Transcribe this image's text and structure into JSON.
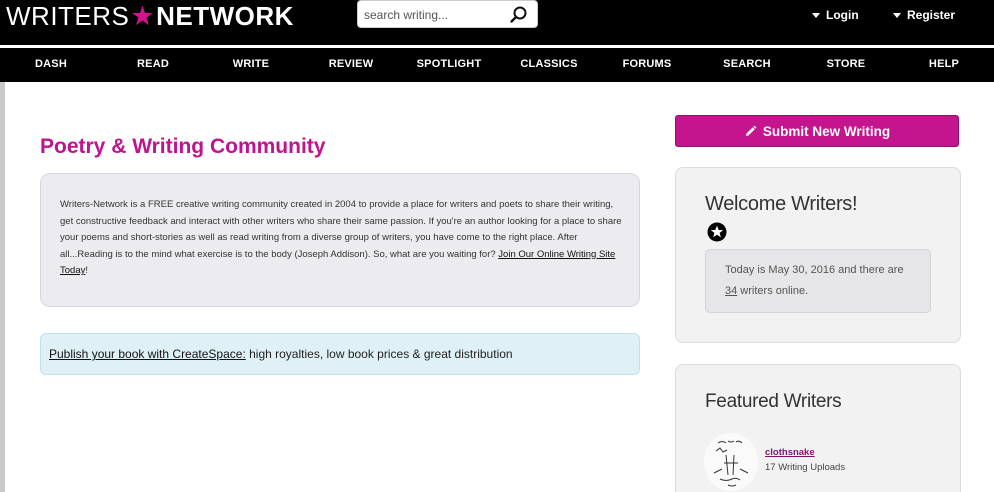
{
  "header": {
    "logo_left": "WRITERS",
    "logo_star": "★",
    "logo_right": "NETWORK",
    "search_placeholder": "search writing...",
    "login_label": "Login",
    "register_label": "Register"
  },
  "nav": {
    "items": [
      "DASH",
      "READ",
      "WRITE",
      "REVIEW",
      "SPOTLIGHT",
      "CLASSICS",
      "FORUMS",
      "SEARCH",
      "STORE",
      "HELP"
    ]
  },
  "main": {
    "title": "Poetry & Writing Community",
    "intro_text": "Writers-Network is a FREE creative writing community created in 2004 to provide a place for writers and poets to share their writing, get constructive feedback and interact with other writers who share their same passion. If you're an author looking for a place to share your poems and short-stories as well as read writing from a diverse group of writers, you have come to the right place. After all...Reading is to the mind what exercise is to the body (Joseph Addison). So, what are you waiting for?",
    "intro_link": "Join Our Online Writing Site Today",
    "intro_suffix": "!",
    "publish_link": "Publish your book with CreateSpace:",
    "publish_text": " high royalties, low book prices & great distribution"
  },
  "sidebar": {
    "submit_label": "Submit New Writing",
    "welcome_title": "Welcome Writers!",
    "today_text": "Today is May 30, 2016 and there are",
    "online_count": "34",
    "online_suffix": " writers online.",
    "featured_title": "Featured Writers",
    "featured_writer": {
      "name": "clothsnake",
      "uploads": "17 Writing Uploads"
    }
  },
  "colors": {
    "brand": "#c4148e",
    "nav_bg": "#000000",
    "panel_bg": "#f2f2f3",
    "info_bg": "#dff1f7"
  }
}
